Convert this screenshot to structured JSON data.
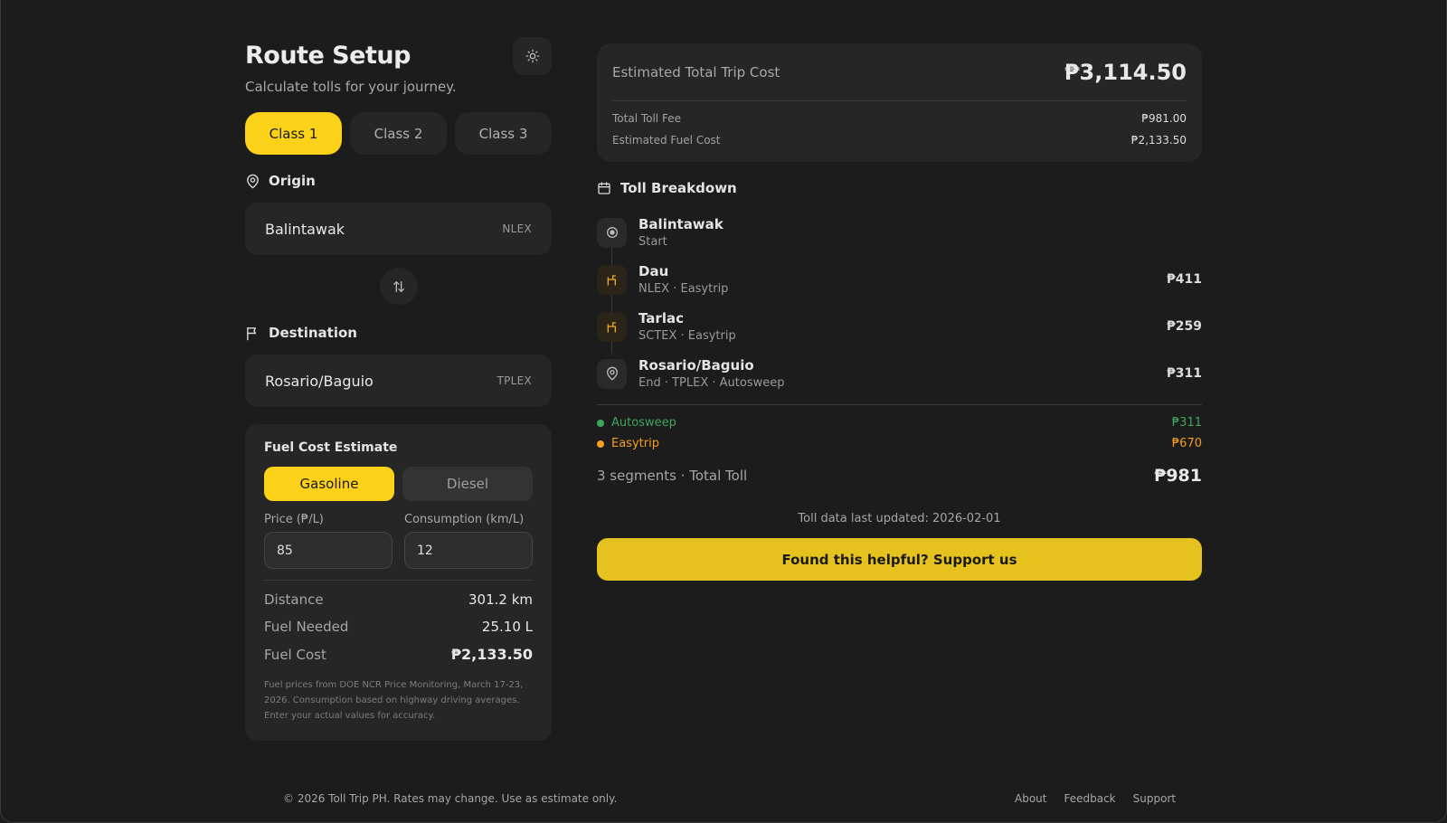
{
  "header": {
    "title": "Route Setup",
    "subtitle": "Calculate tolls for your journey.",
    "theme_icon": "sun-icon"
  },
  "vehicle_classes": {
    "items": [
      "Class 1",
      "Class 2",
      "Class 3"
    ],
    "selected": "Class 1"
  },
  "origin": {
    "label": "Origin",
    "value": "Balintawak",
    "expressway": "NLEX"
  },
  "destination": {
    "label": "Destination",
    "value": "Rosario/Baguio",
    "expressway": "TPLEX"
  },
  "fuel": {
    "title": "Fuel Cost Estimate",
    "types": [
      "Gasoline",
      "Diesel"
    ],
    "selected": "Gasoline",
    "price_label": "Price (₱/L)",
    "price_value": "85",
    "consumption_label": "Consumption (km/L)",
    "consumption_value": "12",
    "stats": [
      {
        "label": "Distance",
        "value": "301.2 km"
      },
      {
        "label": "Fuel Needed",
        "value": "25.10 L"
      },
      {
        "label": "Fuel Cost",
        "value": "₱2,133.50"
      }
    ],
    "note": "Fuel prices from DOE NCR Price Monitoring, March 17-23, 2026. Consumption based on highway driving averages. Enter your actual values for accuracy."
  },
  "totals": {
    "label": "Estimated Total Trip Cost",
    "amount": "₱3,114.50",
    "toll_label": "Total Toll Fee",
    "toll_value": "₱981.00",
    "fuel_label": "Estimated Fuel Cost",
    "fuel_value": "₱2,133.50"
  },
  "breakdown": {
    "title": "Toll Breakdown",
    "stops": [
      {
        "name": "Balintawak",
        "sub": "Start",
        "fee": "",
        "icon": "target-icon"
      },
      {
        "name": "Dau",
        "sub": "NLEX · Easytrip",
        "fee": "₱411",
        "icon": "toll-gate-icon"
      },
      {
        "name": "Tarlac",
        "sub": "SCTEX · Easytrip",
        "fee": "₱259",
        "icon": "toll-gate-icon"
      },
      {
        "name": "Rosario/Baguio",
        "sub": "End · TPLEX · Autosweep",
        "fee": "₱311",
        "icon": "map-pin-icon"
      }
    ],
    "legend": [
      {
        "name": "Autosweep",
        "value": "₱311",
        "color": "#3fa65e"
      },
      {
        "name": "Easytrip",
        "value": "₱670",
        "color": "#f59e22"
      }
    ],
    "summary_label": "3 segments · Total Toll",
    "summary_value": "₱981"
  },
  "updated": "Toll data last updated: 2026-02-01",
  "support_label": "Found this helpful? Support us",
  "footer": {
    "copyright": "© 2026 Toll Trip PH. Rates may change. Use as estimate only.",
    "links": [
      "About",
      "Feedback",
      "Support"
    ]
  },
  "colors": {
    "accent": "#fbd219",
    "background": "#1c1c1c",
    "card": "#262626"
  }
}
